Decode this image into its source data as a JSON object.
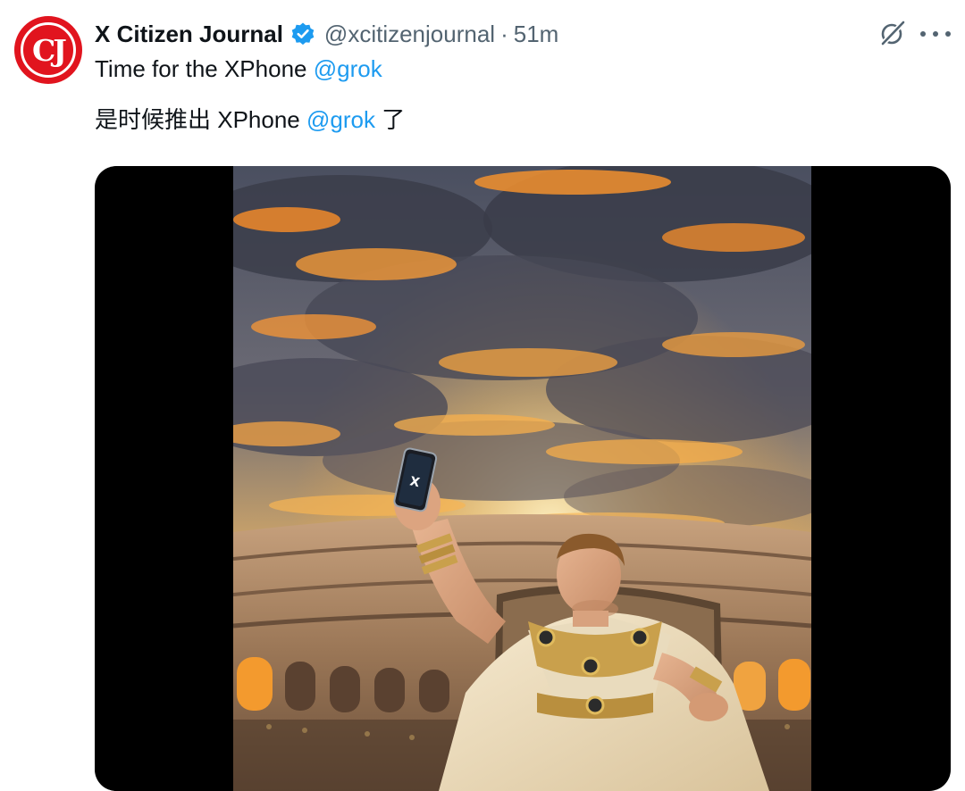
{
  "author": {
    "avatar_initials": "CJ",
    "name": "X Citizen Journal",
    "handle": "@xcitizenjournal",
    "separator": "·",
    "time": "51m"
  },
  "tweet": {
    "line1_text": "Time for the XPhone ",
    "line1_mention": "@grok",
    "line2_prefix": "是时候推出 XPhone ",
    "line2_mention": "@grok",
    "line2_suffix": " 了"
  },
  "media": {
    "phone_logo": "X"
  },
  "icons": {
    "verified": "verified-badge-icon",
    "grok": "grok-icon",
    "more": "more-options-icon"
  },
  "colors": {
    "brand_red": "#e1141e",
    "link_blue": "#1d9bf0",
    "secondary_text": "#536471",
    "primary_text": "#0f1419"
  }
}
